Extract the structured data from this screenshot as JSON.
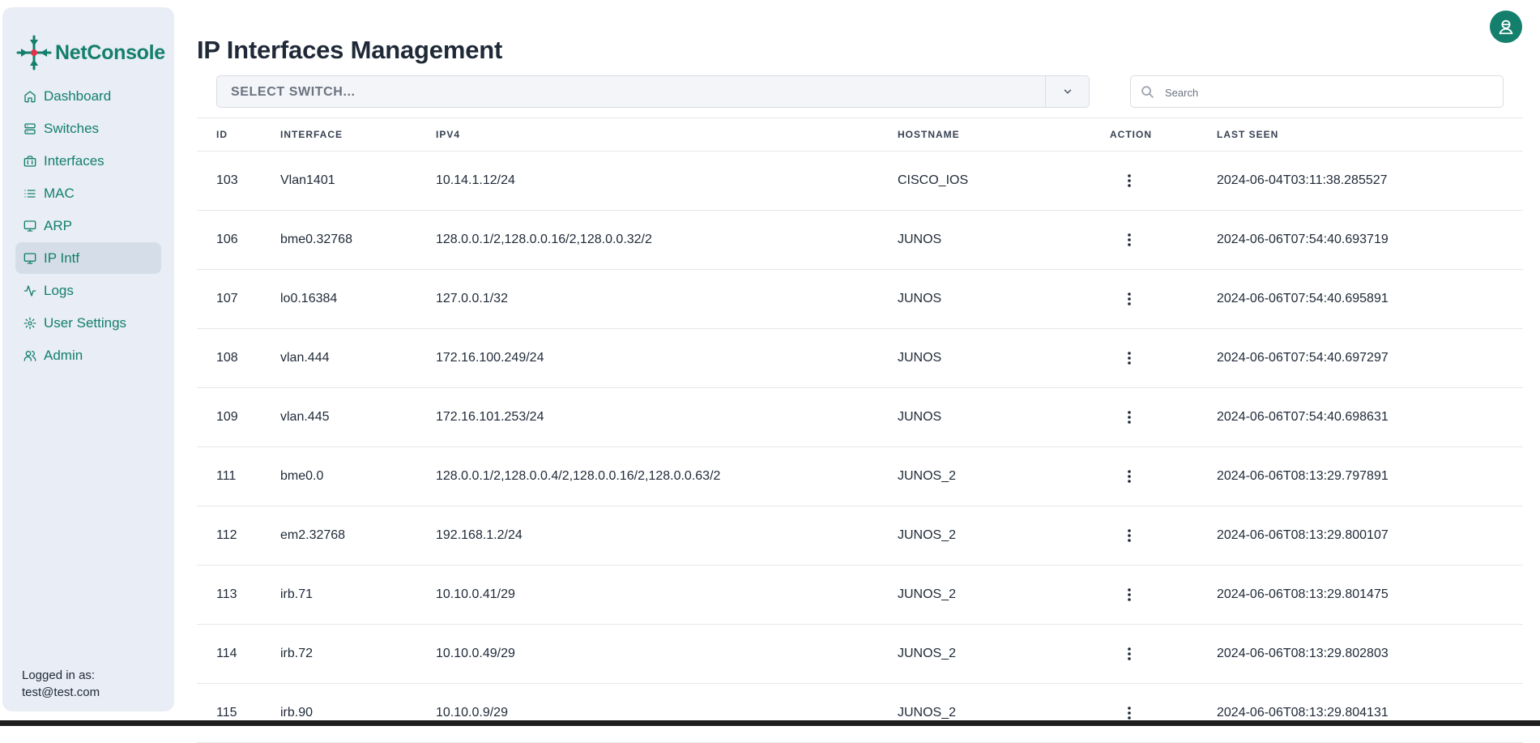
{
  "app": {
    "name": "NetConsole",
    "brand_color": "#137f6c"
  },
  "sidebar": {
    "items": [
      {
        "label": "Dashboard",
        "icon": "home-icon",
        "active": false
      },
      {
        "label": "Switches",
        "icon": "server-icon",
        "active": false
      },
      {
        "label": "Interfaces",
        "icon": "network-icon",
        "active": false
      },
      {
        "label": "MAC",
        "icon": "list-icon",
        "active": false
      },
      {
        "label": "ARP",
        "icon": "monitor-icon",
        "active": false
      },
      {
        "label": "IP Intf",
        "icon": "monitor-icon",
        "active": true
      },
      {
        "label": "Logs",
        "icon": "activity-icon",
        "active": false
      },
      {
        "label": "User Settings",
        "icon": "gear-icon",
        "active": false
      },
      {
        "label": "Admin",
        "icon": "users-icon",
        "active": false
      }
    ],
    "logged_in_label": "Logged in as:",
    "logged_in_user": "test@test.com"
  },
  "page": {
    "title": "IP Interfaces Management"
  },
  "toolbar": {
    "switch_select_placeholder": "SELECT SWITCH...",
    "search_placeholder": "Search"
  },
  "table": {
    "columns": [
      "ID",
      "INTERFACE",
      "IPV4",
      "HOSTNAME",
      "ACTION",
      "LAST SEEN"
    ],
    "rows": [
      {
        "id": "103",
        "interface": "Vlan1401",
        "ipv4": "10.14.1.12/24",
        "hostname": "CISCO_IOS",
        "last_seen": "2024-06-04T03:11:38.285527"
      },
      {
        "id": "106",
        "interface": "bme0.32768",
        "ipv4": "128.0.0.1/2,128.0.0.16/2,128.0.0.32/2",
        "hostname": "JUNOS",
        "last_seen": "2024-06-06T07:54:40.693719"
      },
      {
        "id": "107",
        "interface": "lo0.16384",
        "ipv4": "127.0.0.1/32",
        "hostname": "JUNOS",
        "last_seen": "2024-06-06T07:54:40.695891"
      },
      {
        "id": "108",
        "interface": "vlan.444",
        "ipv4": "172.16.100.249/24",
        "hostname": "JUNOS",
        "last_seen": "2024-06-06T07:54:40.697297"
      },
      {
        "id": "109",
        "interface": "vlan.445",
        "ipv4": "172.16.101.253/24",
        "hostname": "JUNOS",
        "last_seen": "2024-06-06T07:54:40.698631"
      },
      {
        "id": "111",
        "interface": "bme0.0",
        "ipv4": "128.0.0.1/2,128.0.0.4/2,128.0.0.16/2,128.0.0.63/2",
        "hostname": "JUNOS_2",
        "last_seen": "2024-06-06T08:13:29.797891"
      },
      {
        "id": "112",
        "interface": "em2.32768",
        "ipv4": "192.168.1.2/24",
        "hostname": "JUNOS_2",
        "last_seen": "2024-06-06T08:13:29.800107"
      },
      {
        "id": "113",
        "interface": "irb.71",
        "ipv4": "10.10.0.41/29",
        "hostname": "JUNOS_2",
        "last_seen": "2024-06-06T08:13:29.801475"
      },
      {
        "id": "114",
        "interface": "irb.72",
        "ipv4": "10.10.0.49/29",
        "hostname": "JUNOS_2",
        "last_seen": "2024-06-06T08:13:29.802803"
      },
      {
        "id": "115",
        "interface": "irb.90",
        "ipv4": "10.10.0.9/29",
        "hostname": "JUNOS_2",
        "last_seen": "2024-06-06T08:13:29.804131"
      }
    ]
  }
}
